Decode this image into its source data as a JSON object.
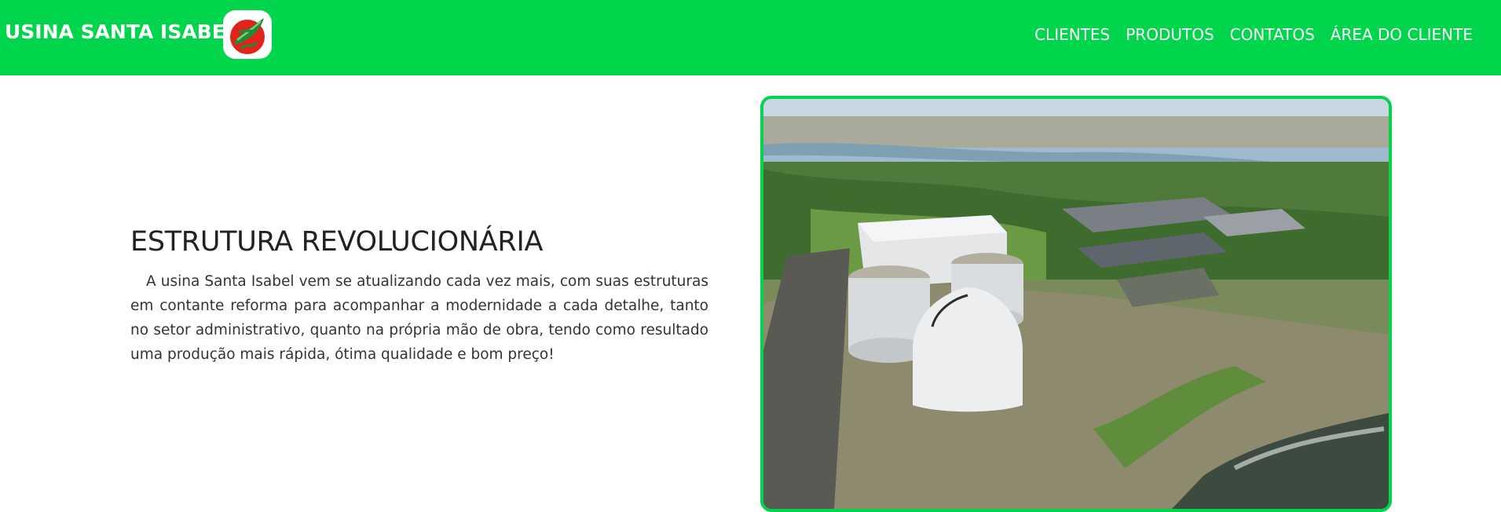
{
  "navbar": {
    "brand": "USINA SANTA ISABEL",
    "links": [
      {
        "label": "CLIENTES"
      },
      {
        "label": "PRODUTOS"
      },
      {
        "label": "CONTATOS"
      },
      {
        "label": "ÁREA DO CLIENTE"
      }
    ]
  },
  "section": {
    "title": "ESTRUTURA REVOLUCIONÁRIA",
    "text": "A usina Santa Isabel vem se atualizando cada vez mais, com suas estruturas em contante reforma para acompanhar a modernidade a cada detalhe, tanto no setor administrativo, quanto na própria mão de obra, tendo como resultado uma produção mais rápida, ótima qualidade e bom preço!"
  },
  "colors": {
    "brand_green": "#00d54b",
    "text_dark": "#222222"
  },
  "icons": {
    "logo": "leaf-logo-icon"
  }
}
